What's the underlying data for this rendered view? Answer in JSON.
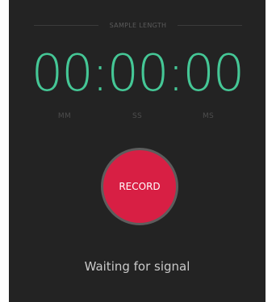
{
  "header": {
    "label": "SAMPLE LENGTH"
  },
  "timer": {
    "display": "00:00:00",
    "units": {
      "mm": "MM",
      "ss": "SS",
      "ms": "MS"
    }
  },
  "record": {
    "label": "RECORD"
  },
  "status": {
    "text": "Waiting for signal"
  },
  "colors": {
    "background": "#232323",
    "timer": "#45c796",
    "record": "#d81f44"
  }
}
